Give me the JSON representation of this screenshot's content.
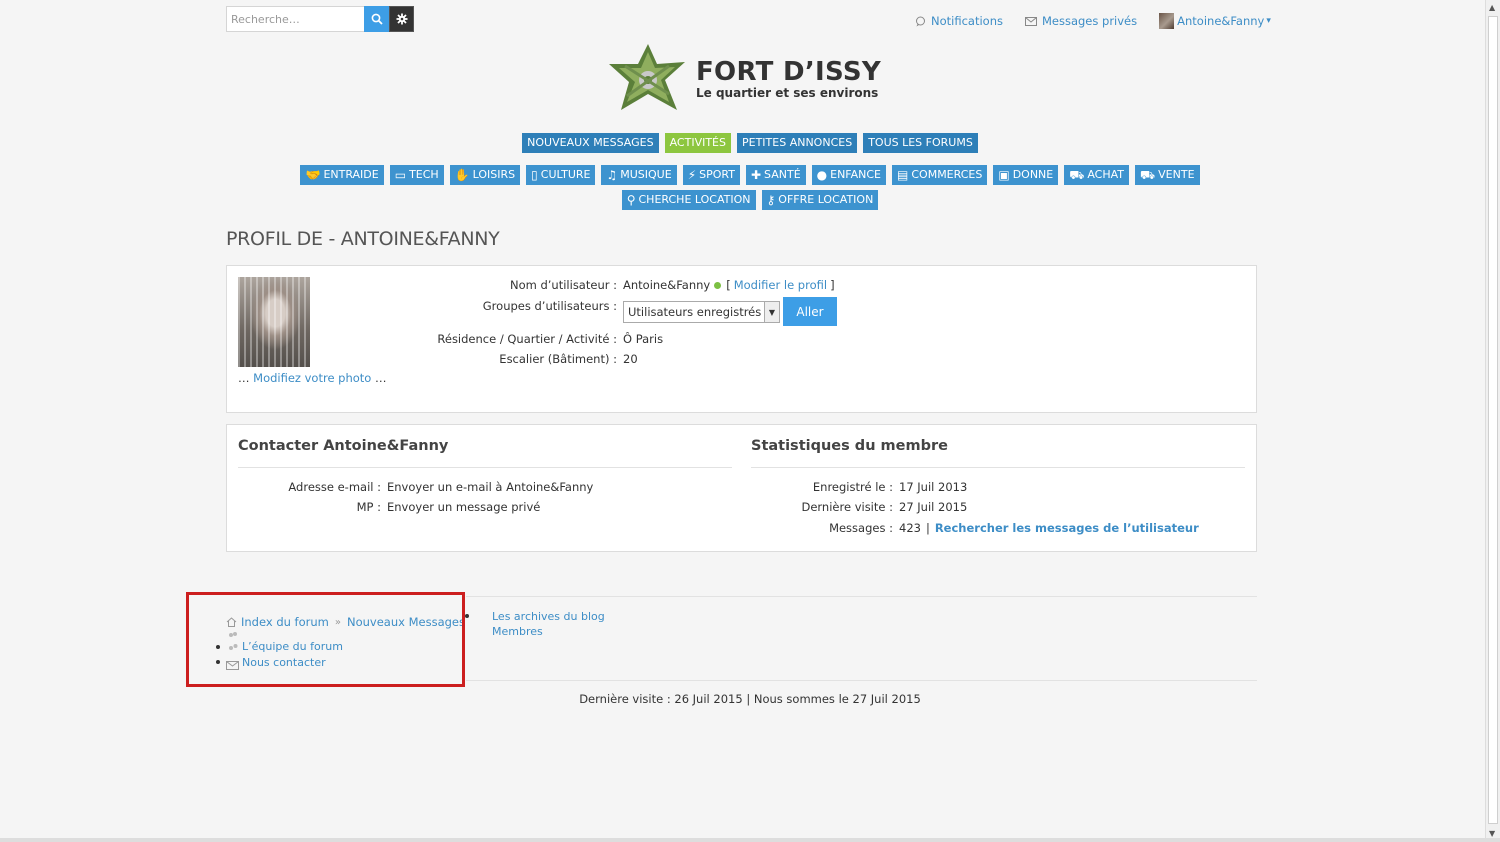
{
  "search": {
    "placeholder": "Recherche…"
  },
  "topnav": {
    "notifications": "Notifications",
    "private_messages": "Messages privés",
    "username": "Antoine&Fanny",
    "dropdown_arrow": "▾"
  },
  "logo": {
    "title": "FORT D’ISSY",
    "subtitle": "Le quartier et ses environs"
  },
  "main_nav": [
    {
      "label": "NOUVEAUX MESSAGES",
      "active": false
    },
    {
      "label": "ACTIVITÉS",
      "active": true
    },
    {
      "label": "PETITES ANNONCES",
      "active": false
    },
    {
      "label": "TOUS LES FORUMS",
      "active": false
    }
  ],
  "category_nav_row1": [
    {
      "label": "ENTRAIDE",
      "icon": "handshake-icon"
    },
    {
      "label": "TECH",
      "icon": "monitor-icon"
    },
    {
      "label": "LOISIRS",
      "icon": "hand-icon"
    },
    {
      "label": "CULTURE",
      "icon": "book-icon"
    },
    {
      "label": "MUSIQUE",
      "icon": "music-icon"
    },
    {
      "label": "SPORT",
      "icon": "runner-icon"
    },
    {
      "label": "SANTÉ",
      "icon": "plus-icon"
    },
    {
      "label": "ENFANCE",
      "icon": "child-icon"
    },
    {
      "label": "COMMERCES",
      "icon": "store-icon"
    },
    {
      "label": "DONNE",
      "icon": "gift-icon"
    },
    {
      "label": "ACHAT",
      "icon": "basket-icon"
    },
    {
      "label": "VENTE",
      "icon": "cart-icon"
    }
  ],
  "category_nav_row2": [
    {
      "label": "CHERCHE LOCATION",
      "icon": "search-icon"
    },
    {
      "label": "OFFRE LOCATION",
      "icon": "keys-icon"
    }
  ],
  "profile": {
    "page_title": "PROFIL DE - ANTOINE&FANNY",
    "photo_prefix": "…",
    "photo_link": "Modifiez votre photo",
    "photo_suffix": "…",
    "username_label": "Nom d’utilisateur :",
    "username_value": "Antoine&Fanny",
    "edit_open": "[",
    "edit_link": "Modifier le profil",
    "edit_close": "]",
    "groups_label": "Groupes d’utilisateurs :",
    "groups_selected": "Utilisateurs enregistrés",
    "go_label": "Aller",
    "residence_label": "Résidence / Quartier / Activité :",
    "residence_value": "Ô Paris",
    "stair_label": "Escalier (Bâtiment) :",
    "stair_value": "20"
  },
  "contact": {
    "title": "Contacter Antoine&Fanny",
    "email_label": "Adresse e-mail :",
    "email_link": "Envoyer un e-mail à Antoine&Fanny",
    "pm_label": "MP :",
    "pm_link": "Envoyer un message privé"
  },
  "stats": {
    "title": "Statistiques du membre",
    "registered_label": "Enregistré le :",
    "registered_value": "17 Juil 2013",
    "last_visit_label": "Dernière visite :",
    "last_visit_value": "27 Juil 2015",
    "messages_label": "Messages :",
    "messages_value": "423",
    "separator": "|",
    "search_link": "Rechercher les messages de l’utilisateur"
  },
  "footer": {
    "breadcrumb_index": "Index du forum",
    "breadcrumb_sep": "»",
    "breadcrumb_new": "Nouveaux Messages",
    "team": "L’équipe du forum",
    "contact": "Nous contacter",
    "blog": "Les archives du blog",
    "members": "Membres",
    "status": "Dernière visite : 26 Juil 2015 | Nous sommes le 27 Juil 2015"
  },
  "colors": {
    "nav_blue": "#2e7fb8",
    "category_blue": "#3d93cf",
    "active_green": "#8dc63f",
    "link": "#3d8dc6",
    "highlight": "#cc1f1f"
  }
}
